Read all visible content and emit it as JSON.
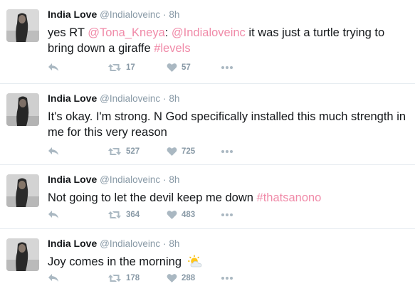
{
  "tweets": [
    {
      "name": "India Love",
      "handle": "@Indialoveinc",
      "dot": "·",
      "time": "8h",
      "text_parts": [
        {
          "text": "yes RT ",
          "link": false
        },
        {
          "text": "@Tona_Kneya",
          "link": true
        },
        {
          "text": ": ",
          "link": false
        },
        {
          "text": "@Indialoveinc",
          "link": true
        },
        {
          "text": " it was just a turtle trying to bring down a giraffe ",
          "link": false
        },
        {
          "text": "#levels",
          "link": true
        }
      ],
      "retweets": "17",
      "likes": "57"
    },
    {
      "name": "India Love",
      "handle": "@Indialoveinc",
      "dot": "·",
      "time": "8h",
      "text_parts": [
        {
          "text": "It's okay. I'm strong. N God specifically installed this much strength in me for this very reason",
          "link": false
        }
      ],
      "retweets": "527",
      "likes": "725"
    },
    {
      "name": "India Love",
      "handle": "@Indialoveinc",
      "dot": "·",
      "time": "8h",
      "text_parts": [
        {
          "text": "Not going to let the devil keep me down ",
          "link": false
        },
        {
          "text": "#thatsanono",
          "link": true
        }
      ],
      "retweets": "364",
      "likes": "483"
    },
    {
      "name": "India Love",
      "handle": "@Indialoveinc",
      "dot": "·",
      "time": "8h",
      "text_parts": [
        {
          "text": "Joy comes in the morning ",
          "link": false
        }
      ],
      "emoji": "sun-behind-cloud-icon",
      "retweets": "178",
      "likes": "288"
    }
  ],
  "colors": {
    "link": "#f08aa8",
    "meta": "#8899a6",
    "icon": "#aab8c2",
    "divider": "#e6ecf0"
  },
  "icons": [
    "reply-icon",
    "retweet-icon",
    "like-icon",
    "more-icon",
    "sun-behind-cloud-icon"
  ]
}
